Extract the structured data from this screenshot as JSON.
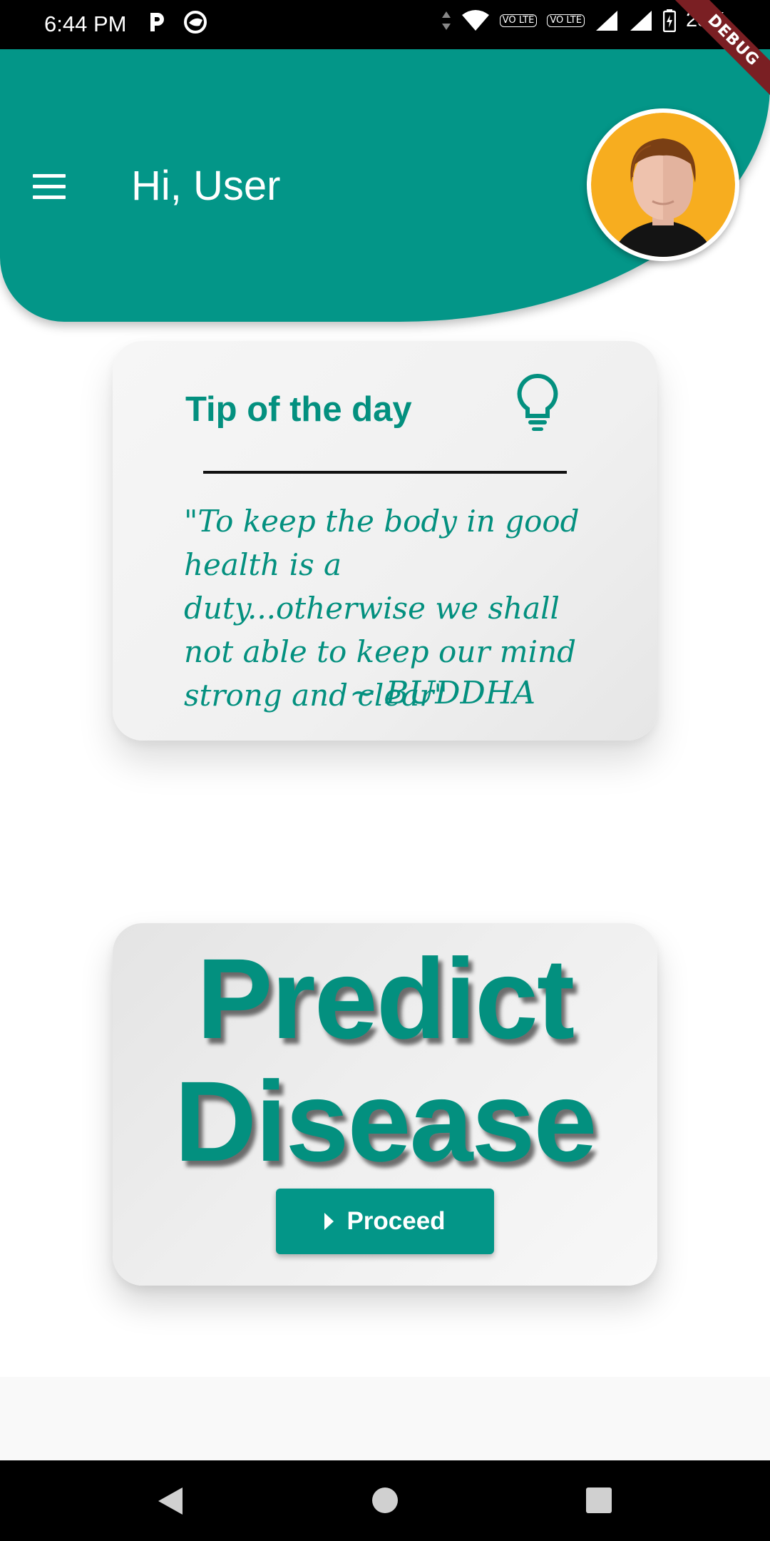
{
  "status_bar": {
    "time": "6:44 PM",
    "battery": "25%",
    "volte_1": "VO LTE",
    "volte_2": "VO LTE",
    "icons": [
      "parking-app-icon",
      "notification-app-icon",
      "data-arrows-icon",
      "wifi-icon",
      "signal-icon",
      "signal-icon",
      "battery-charging-icon"
    ]
  },
  "debug_banner": "DEBUG",
  "header": {
    "greeting": "Hi,  User",
    "menu_icon": "hamburger-menu-icon",
    "avatar_icon": "user-avatar-icon",
    "background_color": "#039688"
  },
  "tip_card": {
    "title": "Tip of the day",
    "icon": "lightbulb-icon",
    "quote": "\"To keep the body in good health is a duty...otherwise we shall not able to keep our mind strong and clear\"",
    "author": "~ BUDDHA"
  },
  "predict_card": {
    "title_line1": "Predict",
    "title_line2": "Disease",
    "button_label": "Proceed",
    "button_icon": "play-arrow-icon"
  },
  "nav_bar": {
    "back_icon": "back-triangle-icon",
    "home_icon": "home-circle-icon",
    "recents_icon": "recents-square-icon"
  },
  "colors": {
    "accent": "#039688",
    "text_accent": "#03907f"
  }
}
